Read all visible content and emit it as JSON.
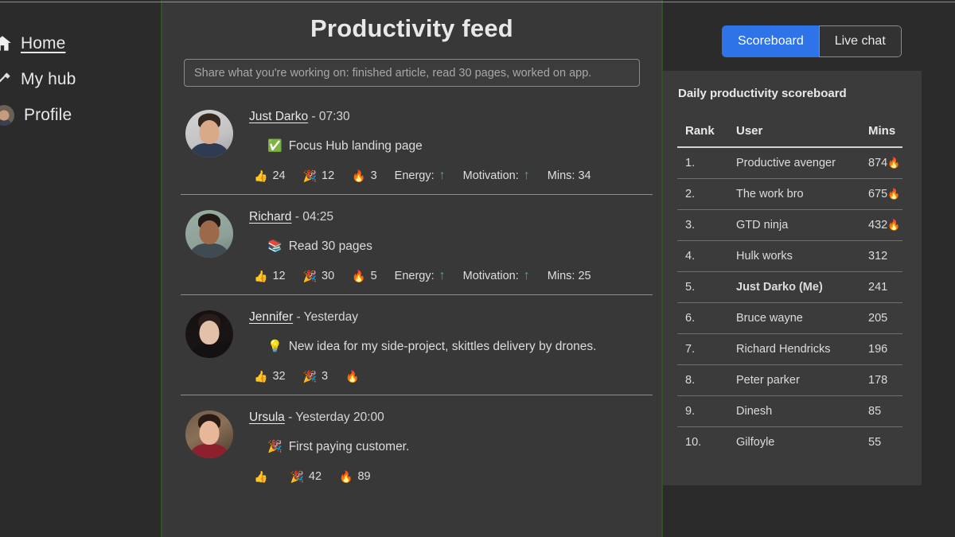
{
  "sidebar": {
    "items": [
      {
        "label": "Home",
        "icon": "home-icon",
        "active": true
      },
      {
        "label": "My hub",
        "icon": "tools-icon",
        "active": false
      },
      {
        "label": "Profile",
        "icon": "avatar-icon",
        "active": false
      }
    ]
  },
  "feed": {
    "title": "Productivity feed",
    "compose": {
      "value": "",
      "placeholder": "Share what you're working on: finished article, read 30 pages, worked on app."
    },
    "posts": [
      {
        "author": "Just Darko",
        "time": "- 07:30",
        "emoji": "✅",
        "text": "Focus Hub landing page",
        "thumbs": "24",
        "party": "12",
        "fire": "3",
        "energy_label": "Energy:",
        "motivation_label": "Motivation:",
        "mins_label": "Mins: 34",
        "has_stats": true
      },
      {
        "author": "Richard",
        "time": "- 04:25",
        "emoji": "📚",
        "text": "Read 30 pages",
        "thumbs": "12",
        "party": "30",
        "fire": "5",
        "energy_label": "Energy:",
        "motivation_label": "Motivation:",
        "mins_label": "Mins: 25",
        "has_stats": true
      },
      {
        "author": "Jennifer",
        "time": "- Yesterday",
        "emoji": "💡",
        "text": "New idea for my side-project, skittles delivery by drones.",
        "thumbs": "32",
        "party": "3",
        "fire": "",
        "energy_label": "",
        "motivation_label": "",
        "mins_label": "",
        "has_stats": false
      },
      {
        "author": "Ursula",
        "time": "- Yesterday 20:00",
        "emoji": "🎉",
        "text": "First paying customer.",
        "thumbs": "",
        "party": "42",
        "fire": "89",
        "energy_label": "",
        "motivation_label": "",
        "mins_label": "",
        "has_stats": false
      }
    ],
    "icons": {
      "thumbs": "👍",
      "party": "🎉",
      "fire": "🔥",
      "arrow_up": "↑"
    }
  },
  "rail": {
    "tabs": [
      {
        "label": "Scoreboard",
        "active": true
      },
      {
        "label": "Live chat",
        "active": false
      }
    ],
    "panel": {
      "title": "Daily productivity scoreboard",
      "columns": [
        "Rank",
        "User",
        "Mins"
      ],
      "rows": [
        {
          "rank": "1.",
          "user": "Productive avenger",
          "mins": "874",
          "fire": "🔥",
          "me": false
        },
        {
          "rank": "2.",
          "user": "The work bro",
          "mins": "675",
          "fire": "🔥",
          "me": false
        },
        {
          "rank": "3.",
          "user": "GTD ninja",
          "mins": "432",
          "fire": "🔥",
          "me": false
        },
        {
          "rank": "4.",
          "user": "Hulk works",
          "mins": "312",
          "fire": "",
          "me": false
        },
        {
          "rank": "5.",
          "user": "Just Darko (Me)",
          "mins": "241",
          "fire": "",
          "me": true
        },
        {
          "rank": "6.",
          "user": "Bruce wayne",
          "mins": "205",
          "fire": "",
          "me": false
        },
        {
          "rank": "7.",
          "user": "Richard Hendricks",
          "mins": "196",
          "fire": "",
          "me": false
        },
        {
          "rank": "8.",
          "user": "Peter parker",
          "mins": "178",
          "fire": "",
          "me": false
        },
        {
          "rank": "9.",
          "user": "Dinesh",
          "mins": "85",
          "fire": "",
          "me": false
        },
        {
          "rank": "10.",
          "user": "Gilfoyle",
          "mins": "55",
          "fire": "",
          "me": false
        }
      ]
    }
  },
  "colors": {
    "accent_blue": "#2f73e8",
    "accent_green": "#22c55e",
    "border_green": "#2f5227",
    "sidebar_bg": "#2b2b2b",
    "feed_bg": "#383838",
    "panel_bg": "#3b3b3b"
  }
}
